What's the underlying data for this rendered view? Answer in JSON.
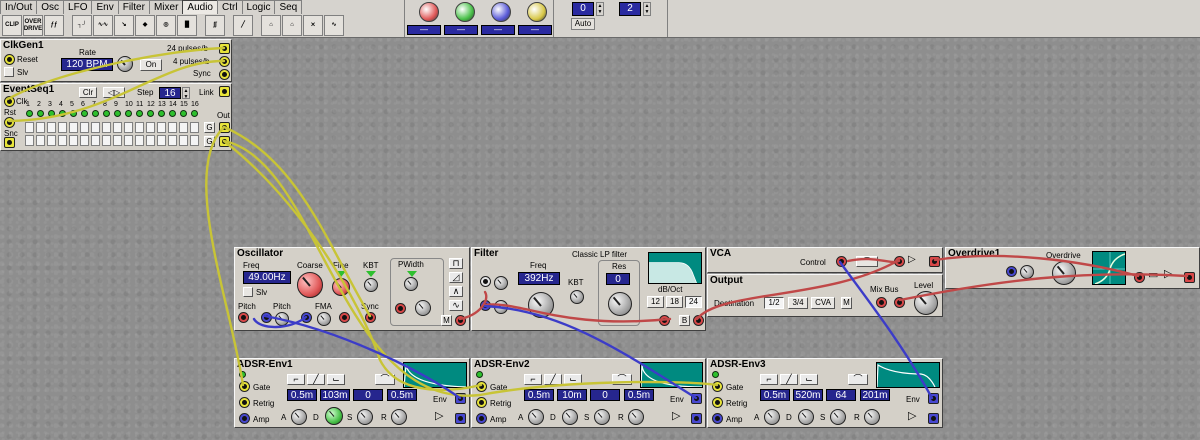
{
  "toolbar": {
    "tabs": [
      "In/Out",
      "Osc",
      "LFO",
      "Env",
      "Filter",
      "Mixer",
      "Audio",
      "Ctrl",
      "Logic",
      "Seq"
    ],
    "active_tab": "Audio",
    "icons": [
      "CLIP",
      "OVER DRIVE",
      "ƒƒ",
      "┐┘",
      "∿∿",
      "↘",
      "◆",
      "◎",
      "█",
      "∫∫",
      "╱",
      "⌂",
      "⌂",
      "⨯",
      "∿"
    ],
    "knob_colors": [
      "#e05858",
      "#48c048",
      "#5a5ad8",
      "#d8c848"
    ],
    "value_left": "0",
    "value_right": "2",
    "auto_label": "Auto"
  },
  "clkgen": {
    "title": "ClkGen1",
    "reset_label": "Reset",
    "slv_label": "Slv",
    "rate_label": "Rate",
    "rate_value": "120 BPM",
    "on_label": "On",
    "out1_label": "24 pulses/b",
    "out2_label": "4 pulses/b",
    "sync_label": "Sync"
  },
  "eventseq": {
    "title": "EventSeq1",
    "clr_label": "Clr",
    "step_label": "Step",
    "step_value": "16",
    "link_label": "Link",
    "clk_label": "Clk",
    "rst_label": "Rst",
    "snc_label": "Snc",
    "step_numbers": [
      "1",
      "2",
      "3",
      "4",
      "5",
      "6",
      "7",
      "8",
      "9",
      "10",
      "11",
      "12",
      "13",
      "14",
      "15",
      "16"
    ],
    "out_label": "Out",
    "g_label": "G"
  },
  "osc": {
    "title": "Oscillator",
    "freq_label": "Freq",
    "freq_value": "49.00Hz",
    "slv_label": "Slv",
    "coarse_label": "Coarse",
    "fine_label": "Fine",
    "kbt_label": "KBT",
    "pitch_label": "Pitch",
    "pitch2_label": "Pitch",
    "fma_label": "FMA",
    "sync_label": "Sync",
    "pwidth_label": "PWidth",
    "m_label": "M"
  },
  "filter": {
    "title": "Filter",
    "subtitle": "Classic LP filter",
    "freq_label": "Freq",
    "freq_value": "392Hz",
    "res_label": "Res",
    "res_value": "0",
    "kbt_label": "KBT",
    "db_label": "dB/Oct",
    "slopes": [
      "12",
      "18",
      "24"
    ],
    "active_slope": "24",
    "b_label": "B"
  },
  "vca": {
    "title": "VCA",
    "control_label": "Control"
  },
  "output": {
    "title": "Output",
    "destination_label": "Destination",
    "destinations": [
      "1/2",
      "3/4",
      "CVA"
    ],
    "active_destination": "1/2",
    "m_label": "M",
    "mixbus_label": "Mix Bus",
    "level_label": "Level"
  },
  "overdrive": {
    "title": "Overdrive1",
    "overdrive_label": "Overdrive"
  },
  "envs": [
    {
      "title": "ADSR-Env1",
      "gate_label": "Gate",
      "retrig_label": "Retrig",
      "amp_label": "Amp",
      "a": "0.5m",
      "d": "103m",
      "s": "0",
      "r": "0.5m",
      "env_label": "Env",
      "a_label": "A",
      "d_label": "D",
      "s_label": "S",
      "r_label": "R"
    },
    {
      "title": "ADSR-Env2",
      "gate_label": "Gate",
      "retrig_label": "Retrig",
      "amp_label": "Amp",
      "a": "0.5m",
      "d": "10m",
      "s": "0",
      "r": "0.5m",
      "env_label": "Env",
      "a_label": "A",
      "d_label": "D",
      "s_label": "S",
      "r_label": "R"
    },
    {
      "title": "ADSR-Env3",
      "gate_label": "Gate",
      "retrig_label": "Retrig",
      "amp_label": "Amp",
      "a": "0.5m",
      "d": "520m",
      "s": "64",
      "r": "201m",
      "env_label": "Env",
      "a_label": "A",
      "d_label": "D",
      "s_label": "S",
      "r_label": "R"
    }
  ],
  "colors": {
    "cable_yellow": "#c8c436",
    "cable_red": "#c04848",
    "cable_blue": "#3c3cc8",
    "display_blue": "#26268e",
    "graph_teal": "#008a80"
  }
}
